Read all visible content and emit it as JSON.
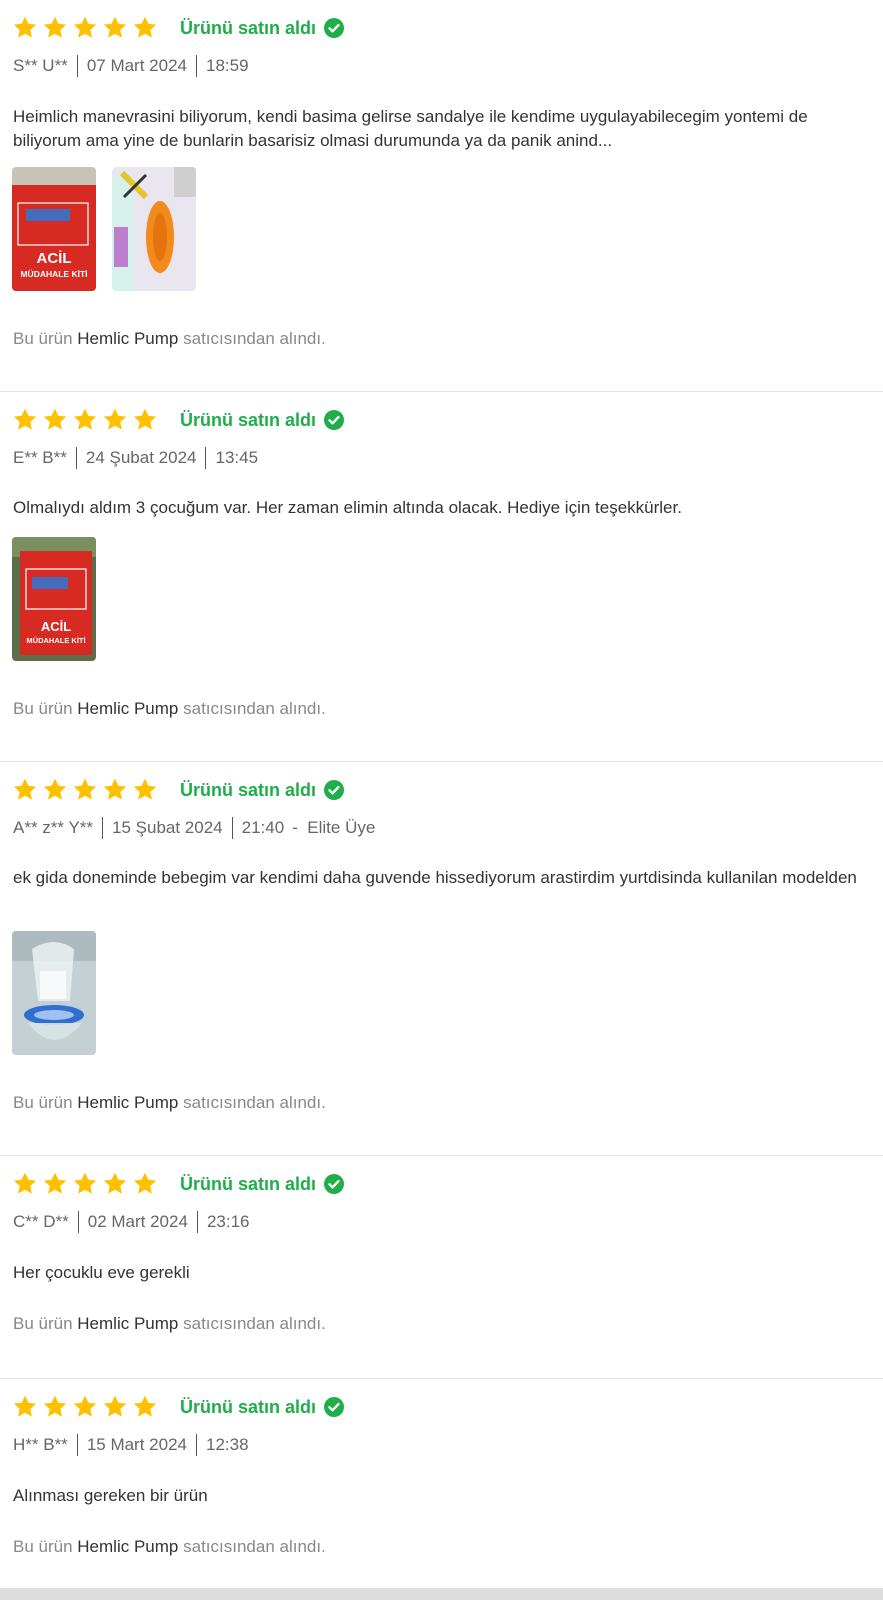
{
  "colors": {
    "star": "#ffc000",
    "verified": "#1fae4a",
    "seller_text": "#888888",
    "meta_text": "#666666"
  },
  "reviews": [
    {
      "rating": 5,
      "verified_label": "Ürünü satın aldı",
      "user": "S** U**",
      "date": "07 Mart 2024",
      "time": "18:59",
      "comment": "Heimlich manevrasini biliyorum, kendi basima gelirse sandalye ile kendime uygulayabilecegim yontemi de biliyorum ama yine de bunlarin basarisiz olmasi durumunda ya da panik anind...",
      "photos": [
        {
          "icon": "product-box-photo",
          "text": "ACİL",
          "subtext": "MÜDAHALE KİTİ"
        },
        {
          "icon": "product-device-photo"
        }
      ],
      "seller_prefix": "Bu ürün",
      "seller_name": "Hemlic Pump",
      "seller_suffix": "satıcısından alındı."
    },
    {
      "rating": 5,
      "verified_label": "Ürünü satın aldı",
      "user": "E** B**",
      "date": "24 Şubat 2024",
      "time": "13:45",
      "comment": "Olmalıydı aldım 3 çocuğum var. Her zaman elimin altında olacak. Hediye için teşekkürler.",
      "photos": [
        {
          "icon": "product-box-photo",
          "text": "ACİL",
          "subtext": "MÜDAHALE KİTİ"
        }
      ],
      "seller_prefix": "Bu ürün",
      "seller_name": "Hemlic Pump",
      "seller_suffix": "satıcısından alındı."
    },
    {
      "rating": 5,
      "verified_label": "Ürünü satın aldı",
      "user": "A** z** Y**",
      "date": "15 Şubat 2024",
      "time": "21:40",
      "badge": "Elite Üye",
      "comment": "ek gida doneminde bebegim var kendimi daha guvende hissediyorum arastirdim yurtdisinda kullanilan modelden",
      "photos": [
        {
          "icon": "product-mask-photo"
        }
      ],
      "seller_prefix": "Bu ürün",
      "seller_name": "Hemlic Pump",
      "seller_suffix": "satıcısından alındı."
    },
    {
      "rating": 5,
      "verified_label": "Ürünü satın aldı",
      "user": "C** D**",
      "date": "02 Mart 2024",
      "time": "23:16",
      "comment": "Her çocuklu eve gerekli",
      "photos": [],
      "seller_prefix": "Bu ürün",
      "seller_name": "Hemlic Pump",
      "seller_suffix": "satıcısından alındı."
    },
    {
      "rating": 5,
      "verified_label": "Ürünü satın aldı",
      "user": "H** B**",
      "date": "15 Mart 2024",
      "time": "12:38",
      "comment": "Alınması gereken bir ürün",
      "photos": [],
      "seller_prefix": "Bu ürün",
      "seller_name": "Hemlic Pump",
      "seller_suffix": "satıcısından alındı."
    }
  ]
}
